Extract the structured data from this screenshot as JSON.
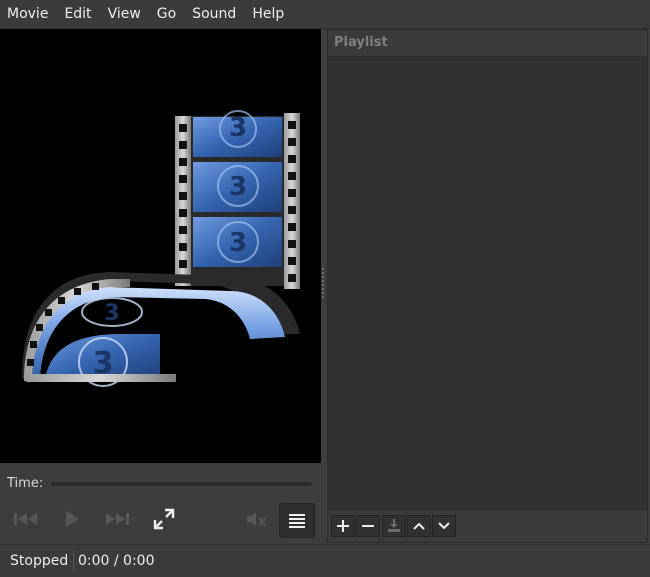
{
  "menubar": {
    "items": [
      {
        "label": "Movie"
      },
      {
        "label": "Edit"
      },
      {
        "label": "View"
      },
      {
        "label": "Go"
      },
      {
        "label": "Sound"
      },
      {
        "label": "Help"
      }
    ]
  },
  "video": {
    "logo_icon": "film-reel-3d-icon",
    "frame_number": "3"
  },
  "seek": {
    "label": "Time:"
  },
  "controls": {
    "previous_icon": "skip-previous-icon",
    "play_icon": "play-icon",
    "next_icon": "skip-next-icon",
    "fullscreen_icon": "fullscreen-icon",
    "volume_icon": "volume-muted-icon",
    "playlist_toggle_icon": "list-icon",
    "playlist_toggle_active": true
  },
  "status": {
    "state": "Stopped",
    "time": "0:00 / 0:00"
  },
  "playlist": {
    "title": "Playlist",
    "items": [],
    "toolbar": {
      "add_icon": "add-icon",
      "remove_icon": "remove-icon",
      "save_icon": "save-icon",
      "move_up_icon": "move-up-icon",
      "move_down_icon": "move-down-icon"
    }
  },
  "colors": {
    "background": "#3b3d3f",
    "video_bg": "#000000",
    "film_blue": "#3c6fb8",
    "text": "#eeeeec"
  }
}
